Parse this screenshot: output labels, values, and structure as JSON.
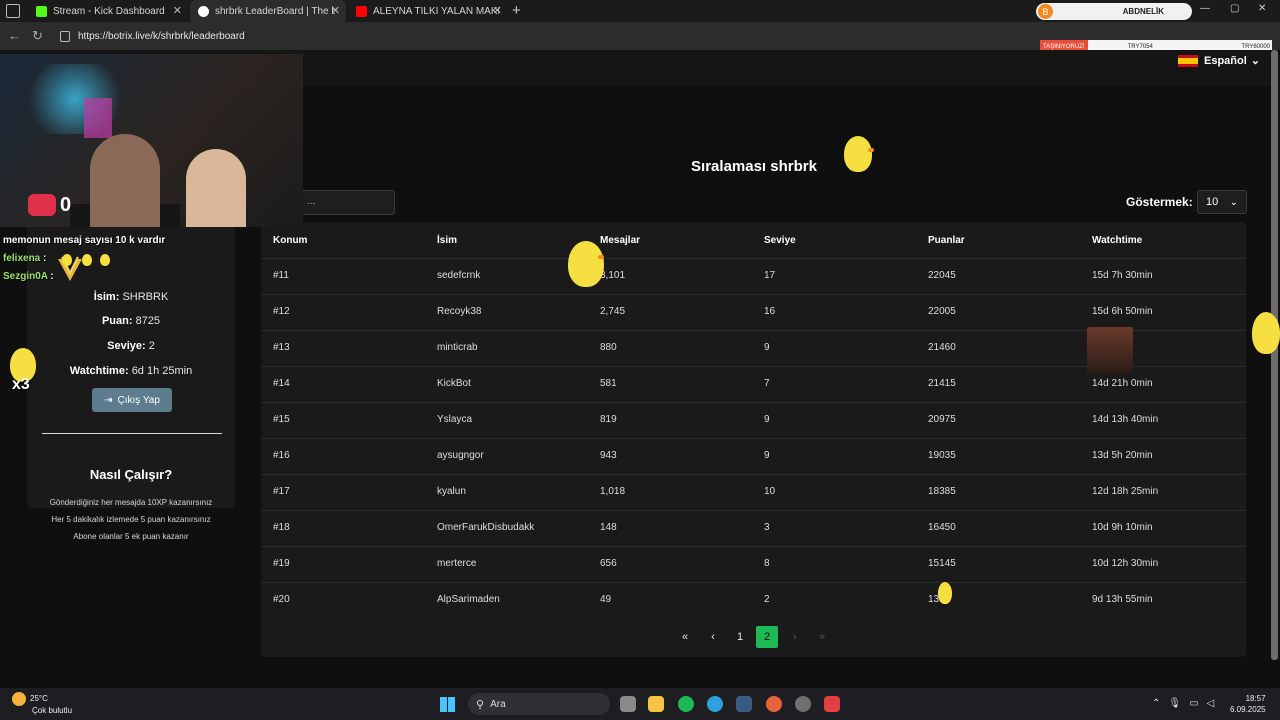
{
  "browser": {
    "tabs": [
      {
        "title": "Stream - Kick Dashboard",
        "fav_color": "#53fc18",
        "active": false
      },
      {
        "title": "shrbrk LeaderBoard | The best Ch",
        "fav_color": "#ffffff",
        "active": true
      },
      {
        "title": "ALEYNA TİLKİ YALAN MAKİNESİN",
        "fav_color": "#ff0000",
        "active": false
      }
    ],
    "url": "https://botrix.live/k/shrbrk/leaderboard",
    "profile_name": "ABDNELİK",
    "profile_initial": "B",
    "ticker": {
      "label": "TAŞINIYORUZ!",
      "a": "TRY7054",
      "b": "TRY60000"
    }
  },
  "header": {
    "language": "Español"
  },
  "user_panel": {
    "name_label": "İsim:",
    "name_value": "SHRBRK",
    "points_label": "Puan:",
    "points_value": "8725",
    "level_label": "Seviye:",
    "level_value": "2",
    "watch_label": "Watchtime:",
    "watch_value": "6d 1h 25min",
    "logout_label": "Çıkış Yap",
    "how_title": "Nasıl Çalışır?",
    "how_lines": [
      "Gönderdiğiniz her mesajda 10XP kazanırsınız",
      "Her 5 dakikalık izlemede 5 puan kazanırsınız",
      "Abone olanlar 5 ek puan kazanır"
    ]
  },
  "leaderboard": {
    "title": "Sıralaması shrbrk",
    "search_placeholder": "...",
    "show_label": "Göstermek:",
    "show_value": "10",
    "columns": [
      "Konum",
      "İsim",
      "Mesajlar",
      "Seviye",
      "Puanlar",
      "Watchtime"
    ],
    "rows": [
      [
        "#11",
        "sedefcrnk",
        "3,101",
        "17",
        "22045",
        "15d 7h 30min"
      ],
      [
        "#12",
        "Recoyk38",
        "2,745",
        "16",
        "22005",
        "15d 6h 50min"
      ],
      [
        "#13",
        "minticrab",
        "880",
        "9",
        "21460",
        "40min"
      ],
      [
        "#14",
        "KickBot",
        "581",
        "7",
        "21415",
        "14d 21h 0min"
      ],
      [
        "#15",
        "Yslayca",
        "819",
        "9",
        "20975",
        "14d 13h 40min"
      ],
      [
        "#16",
        "aysugngor",
        "943",
        "9",
        "19035",
        "13d 5h 20min"
      ],
      [
        "#17",
        "kyalun",
        "1,018",
        "10",
        "18385",
        "12d 18h 25min"
      ],
      [
        "#18",
        "OmerFarukDisbudakk",
        "148",
        "3",
        "16450",
        "10d 9h 10min"
      ],
      [
        "#19",
        "merterce",
        "656",
        "8",
        "15145",
        "10d 12h 30min"
      ],
      [
        "#20",
        "AlpSarimaden",
        "49",
        "2",
        "13 5",
        "9d 13h 55min"
      ]
    ],
    "pagination": {
      "first": "«",
      "prev": "‹",
      "pages": [
        "1",
        "2"
      ],
      "current": "2",
      "next": "›",
      "last": "»"
    }
  },
  "overlay": {
    "heart_count": "0",
    "chat": [
      {
        "text": "memonun mesaj sayısı 10 k vardır"
      },
      {
        "user": "felixena",
        "sep": ":"
      },
      {
        "user": "Sezgin0A",
        "sep": ":"
      }
    ],
    "multiplier": "x3"
  },
  "taskbar": {
    "temp": "25°C",
    "weather": "Çok bulutlu",
    "search": "Ara",
    "time": "18:57",
    "date": "6.09.2025"
  }
}
